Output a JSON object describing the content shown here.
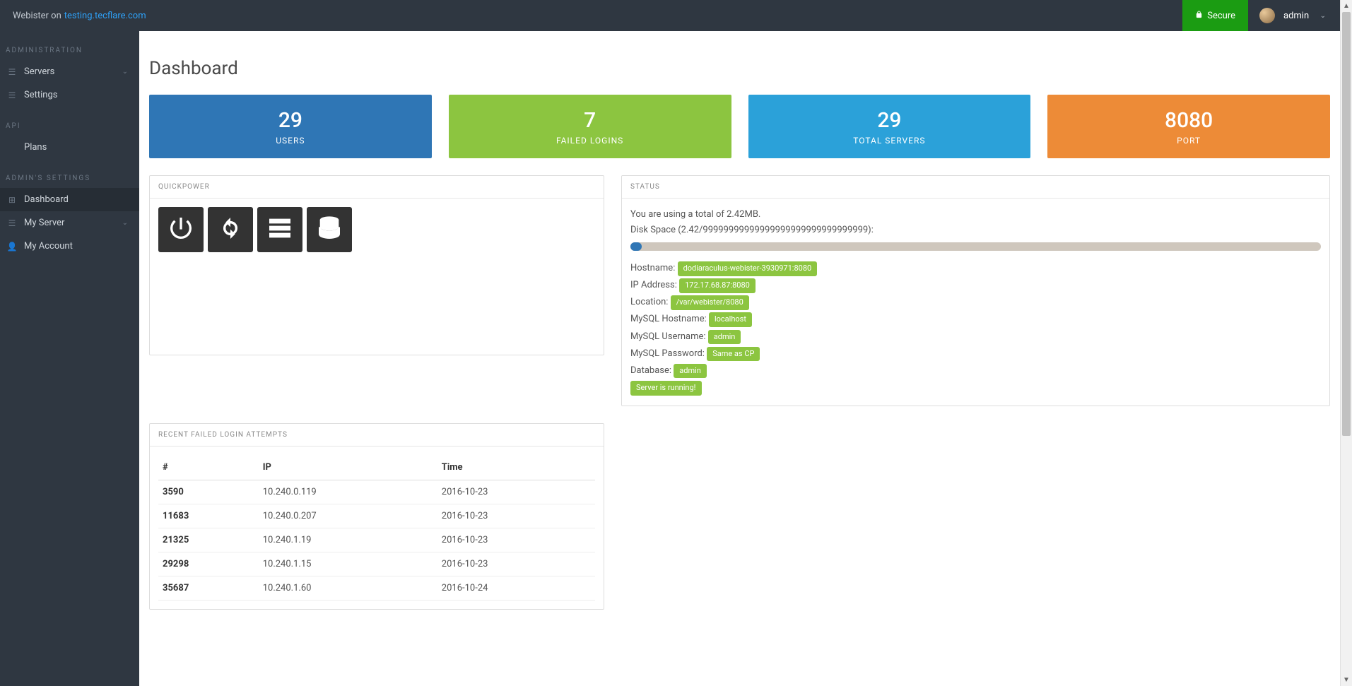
{
  "brand": {
    "prefix": "Webister on ",
    "host": "testing.tecflare.com"
  },
  "topbar": {
    "secure_label": "Secure",
    "username": "admin"
  },
  "sidebar": {
    "sections": [
      {
        "title": "ADMINISTRATION",
        "items": [
          {
            "label": "Servers",
            "icon": "☰",
            "expandable": true
          },
          {
            "label": "Settings",
            "icon": "☰",
            "expandable": false
          }
        ]
      },
      {
        "title": "API",
        "items": [
          {
            "label": "Plans",
            "icon": "",
            "expandable": false
          }
        ]
      },
      {
        "title": "ADMIN'S SETTINGS",
        "items": [
          {
            "label": "Dashboard",
            "icon": "⊞",
            "active": true
          },
          {
            "label": "My Server",
            "icon": "☰",
            "expandable": true
          },
          {
            "label": "My Account",
            "icon": "👤",
            "expandable": false
          }
        ]
      }
    ]
  },
  "page": {
    "title": "Dashboard"
  },
  "stats": [
    {
      "value": "29",
      "label": "USERS",
      "color": "blue"
    },
    {
      "value": "7",
      "label": "FAILED LOGINS",
      "color": "green"
    },
    {
      "value": "29",
      "label": "TOTAL SERVERS",
      "color": "cyan"
    },
    {
      "value": "8080",
      "label": "PORT",
      "color": "orange"
    }
  ],
  "quickpower": {
    "title": "QUICKPOWER"
  },
  "status": {
    "title": "STATUS",
    "usage_line": "You are using a total of 2.42MB.",
    "disk_line": "Disk Space (2.42/99999999999999999999999999999999):",
    "rows": [
      {
        "label": "Hostname:",
        "value": "dodiaraculus-webister-3930971:8080"
      },
      {
        "label": "IP Address:",
        "value": "172.17.68.87:8080"
      },
      {
        "label": "Location:",
        "value": "/var/webister/8080"
      },
      {
        "label": "MySQL Hostname:",
        "value": "localhost"
      },
      {
        "label": "MySQL Username:",
        "value": "admin"
      },
      {
        "label": "MySQL Password:",
        "value": "Same as CP"
      },
      {
        "label": "Database:",
        "value": "admin"
      }
    ],
    "running_badge": "Server is running!"
  },
  "failed_logins": {
    "title": "RECENT FAILED LOGIN ATTEMPTS",
    "columns": [
      "#",
      "IP",
      "Time"
    ],
    "rows": [
      {
        "id": "3590",
        "ip": "10.240.0.119",
        "time": "2016-10-23"
      },
      {
        "id": "11683",
        "ip": "10.240.0.207",
        "time": "2016-10-23"
      },
      {
        "id": "21325",
        "ip": "10.240.1.19",
        "time": "2016-10-23"
      },
      {
        "id": "29298",
        "ip": "10.240.1.15",
        "time": "2016-10-23"
      },
      {
        "id": "35687",
        "ip": "10.240.1.60",
        "time": "2016-10-24"
      }
    ]
  }
}
